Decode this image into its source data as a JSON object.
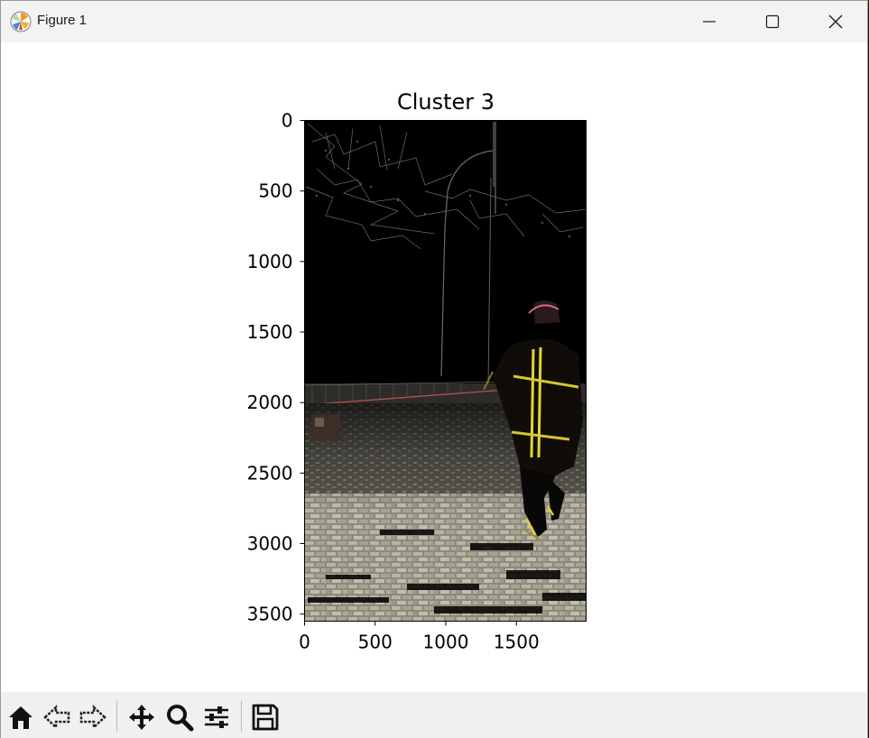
{
  "window": {
    "title": "Figure 1",
    "minimize_icon": "minimize-icon",
    "maximize_icon": "maximize-icon",
    "close_icon": "close-icon"
  },
  "chart_data": {
    "type": "image",
    "title": "Cluster 3",
    "xlabel": "",
    "ylabel": "",
    "xlim": [
      0,
      2000
    ],
    "ylim": [
      3550,
      0
    ],
    "x_ticks": [
      0,
      500,
      1000,
      1500
    ],
    "y_ticks": [
      0,
      500,
      1000,
      1500,
      2000,
      2500,
      3000,
      3500
    ],
    "x_tick_labels": [
      "0",
      "500",
      "1000",
      "1500"
    ],
    "y_tick_labels": [
      "0",
      "500",
      "1000",
      "1500",
      "2000",
      "2500",
      "3000",
      "3500"
    ]
  },
  "toolbar": {
    "buttons": [
      {
        "name": "home-button",
        "icon": "home-icon"
      },
      {
        "name": "back-button",
        "icon": "back-arrow-icon"
      },
      {
        "name": "forward-button",
        "icon": "forward-arrow-icon"
      },
      {
        "name": "pan-button",
        "icon": "move-icon"
      },
      {
        "name": "zoom-button",
        "icon": "magnifier-icon"
      },
      {
        "name": "configure-subplots-button",
        "icon": "sliders-icon"
      },
      {
        "name": "save-button",
        "icon": "floppy-disk-icon"
      }
    ]
  }
}
